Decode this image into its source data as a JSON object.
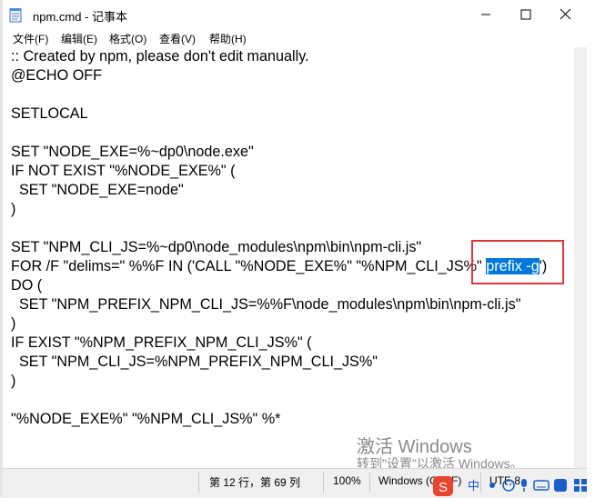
{
  "window": {
    "title": "npm.cmd - 记事本"
  },
  "menu": [
    "文件(F)",
    "编辑(E)",
    "格式(O)",
    "查看(V)",
    "帮助(H)"
  ],
  "editor": {
    "lines": [
      ":: Created by npm, please don't edit manually.",
      "@ECHO OFF",
      "",
      "SETLOCAL",
      "",
      "SET \"NODE_EXE=%~dp0\\node.exe\"",
      "IF NOT EXIST \"%NODE_EXE%\" (",
      "  SET \"NODE_EXE=node\"",
      ")",
      "",
      "SET \"NPM_CLI_JS=%~dp0\\node_modules\\npm\\bin\\npm-cli.js\"",
      "FOR /F \"delims=\" %%F IN ('CALL \"%NODE_EXE%\" \"%NPM_CLI_JS%\" prefix -g') DO (",
      "  SET \"NPM_PREFIX_NPM_CLI_JS=%%F\\node_modules\\npm\\bin\\npm-cli.js\"",
      ")",
      "IF EXIST \"%NPM_PREFIX_NPM_CLI_JS%\" (",
      "  SET \"NPM_CLI_JS=%NPM_PREFIX_NPM_CLI_JS%\"",
      ")",
      "",
      "\"%NODE_EXE%\" \"%NPM_CLI_JS%\" %*"
    ],
    "line11_before": "FOR /F \"delims=\" %%F IN ('CALL \"%NODE_EXE%\" \"%NPM_CLI_JS%\" ",
    "line11_selected": "prefix -g",
    "line11_after": "')",
    "line12": "DO ("
  },
  "status": {
    "position": "第 12 行，第 69 列",
    "zoom": "100%",
    "line_ending": "Windows (CRLF)",
    "encoding": "UTF-8"
  },
  "watermark": {
    "title": "激活 Windows",
    "subtitle": "转到\"设置\"以激活 Windows。"
  },
  "tray": {
    "ime": "中"
  },
  "colors": {
    "selection": "#0078d7",
    "highlight_box": "#e0383c"
  }
}
